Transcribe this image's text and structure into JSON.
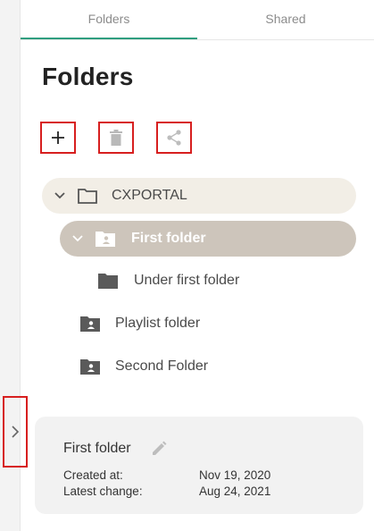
{
  "tabs": [
    {
      "label": "Folders",
      "active": true
    },
    {
      "label": "Shared",
      "active": false
    }
  ],
  "page_title": "Folders",
  "toolbar": {
    "add_icon": "plus-icon",
    "delete_icon": "trash-icon",
    "share_icon": "share-icon"
  },
  "tree": {
    "root": {
      "label": "CXPORTAL",
      "expanded": true,
      "icon": "folder-outline-icon"
    },
    "selected": {
      "label": "First folder",
      "expanded": true,
      "icon": "shared-folder-icon"
    },
    "child": {
      "label": "Under first folder",
      "icon": "folder-icon"
    },
    "items": [
      {
        "label": "Playlist folder",
        "icon": "shared-folder-icon"
      },
      {
        "label": "Second Folder",
        "icon": "shared-folder-icon"
      }
    ]
  },
  "details": {
    "name": "First folder",
    "created_label": "Created at:",
    "created_value": "Nov 19, 2020",
    "changed_label": "Latest change:",
    "changed_value": "Aug 24, 2021"
  },
  "colors": {
    "accent": "#2f9e7f",
    "highlight_border": "#d71f1f",
    "root_bg": "#f2eee6",
    "selected_bg": "#cdc5bb"
  }
}
